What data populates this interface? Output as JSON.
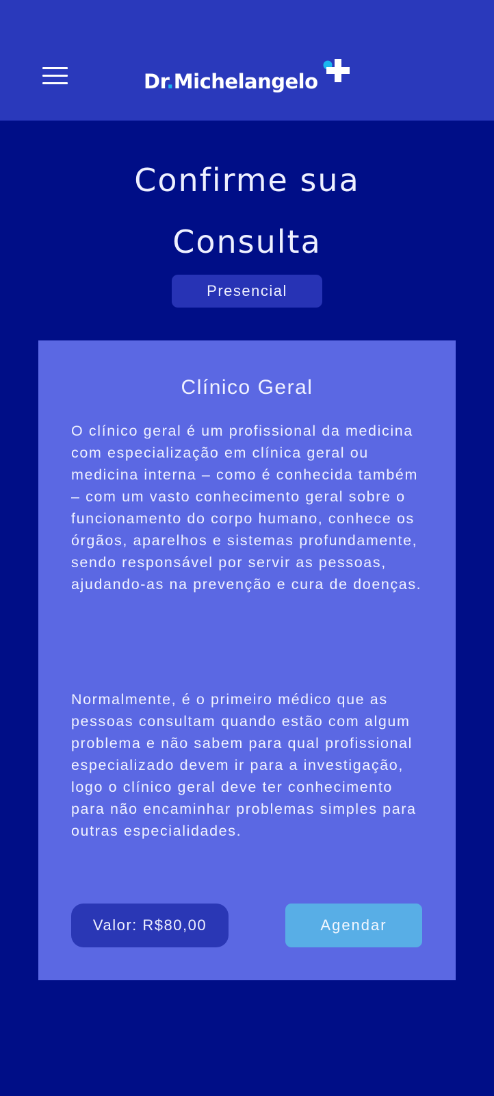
{
  "header": {
    "menu_icon": "hamburger-menu-icon",
    "logo_part1": "Dr",
    "logo_dot": ".",
    "logo_part2": "Michelangelo",
    "logo_icon": "medical-cross-icon",
    "colors": {
      "header_bg": "#2a39bb",
      "logo_accent": "#19b6ee"
    }
  },
  "page": {
    "title_line1": "Confirme sua",
    "title_line2": "Consulta",
    "mode_badge": "Presencial",
    "background": "#000e87"
  },
  "card": {
    "title": "Clínico Geral",
    "paragraph1": "O clínico geral é um profissional da medicina com especialização em clínica geral ou medicina interna – como é conhecida também – com um vasto conhecimento geral sobre o funcionamento do corpo humano, conhece os órgãos, aparelhos e sistemas profundamente, sendo responsável por servir as pessoas, ajudando-as na prevenção e cura de doenças.",
    "paragraph2": "Normalmente, é o primeiro médico que as pessoas consultam quando estão com algum problema e não sabem para qual profissional especializado devem ir para a investigação, logo o clínico geral deve ter conhecimento para não encaminhar problemas simples para outras especialidades.",
    "price_label": "Valor:  R$80,00",
    "schedule_button": "Agendar",
    "colors": {
      "card_bg": "#5b68e3",
      "button_bg": "#58aee6",
      "price_bg": "#2a37b5"
    }
  }
}
